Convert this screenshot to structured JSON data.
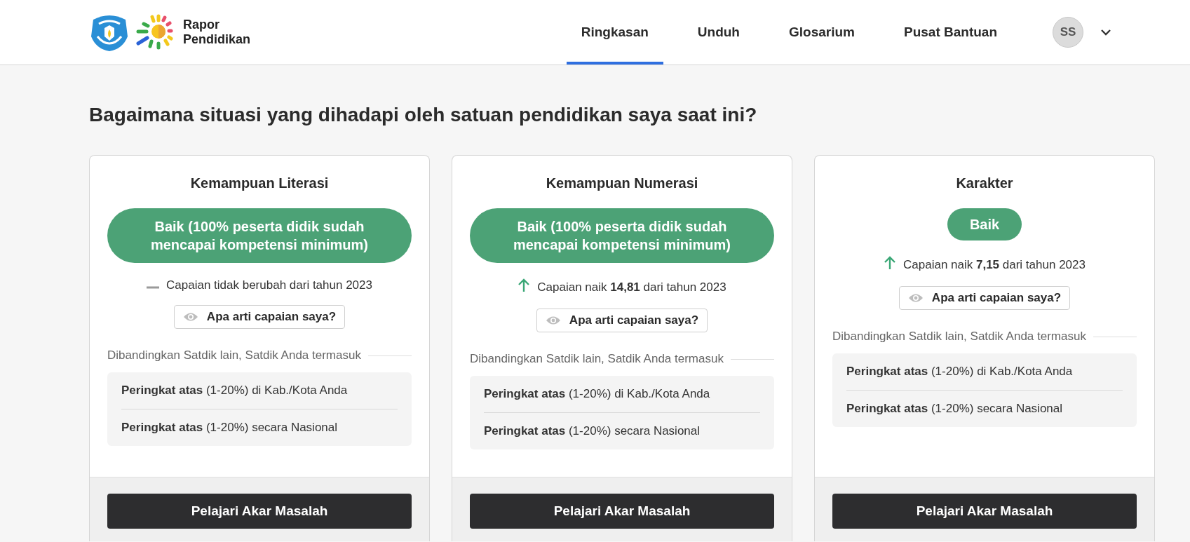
{
  "header": {
    "brand_lines": [
      "Rapor",
      "Pendidikan"
    ],
    "nav": [
      {
        "label": "Ringkasan",
        "selected": true
      },
      {
        "label": "Unduh",
        "selected": false
      },
      {
        "label": "Glosarium",
        "selected": false
      },
      {
        "label": "Pusat Bantuan",
        "selected": false
      }
    ],
    "avatar": "SS"
  },
  "heading": "Bagaimana situasi yang dihadapi oleh satuan pendidikan saya saat ini?",
  "cards": [
    {
      "title": "Kemampuan Literasi",
      "status": "Baik (100% peserta didik sudah mencapai kompetensi minimum)",
      "trend": {
        "kind": "flat",
        "text": "Capaian tidak berubah dari tahun 2023"
      },
      "info_button": "Apa arti capaian saya?",
      "compare_label": "Dibandingkan Satdik lain, Satdik Anda termasuk",
      "ranks": [
        "**Peringkat atas** (1-20%) di Kab./Kota Anda",
        "**Peringkat atas** (1-20%) secara Nasional"
      ],
      "action": "Pelajari Akar Masalah"
    },
    {
      "title": "Kemampuan Numerasi",
      "status": "Baik (100% peserta didik sudah mencapai kompetensi minimum)",
      "trend": {
        "kind": "up",
        "text": "Capaian naik **14,81** dari tahun 2023"
      },
      "info_button": "Apa arti capaian saya?",
      "compare_label": "Dibandingkan Satdik lain, Satdik Anda termasuk",
      "ranks": [
        "**Peringkat atas** (1-20%) di Kab./Kota Anda",
        "**Peringkat atas** (1-20%) secara Nasional"
      ],
      "action": "Pelajari Akar Masalah"
    },
    {
      "title": "Karakter",
      "status": "Baik",
      "trend": {
        "kind": "up",
        "text": "Capaian naik **7,15** dari tahun 2023"
      },
      "info_button": "Apa arti capaian saya?",
      "compare_label": "Dibandingkan Satdik lain, Satdik Anda termasuk",
      "ranks": [
        "**Peringkat atas** (1-20%) di Kab./Kota Anda",
        "**Peringkat atas** (1-20%) secara Nasional"
      ],
      "action": "Pelajari Akar Masalah"
    }
  ]
}
